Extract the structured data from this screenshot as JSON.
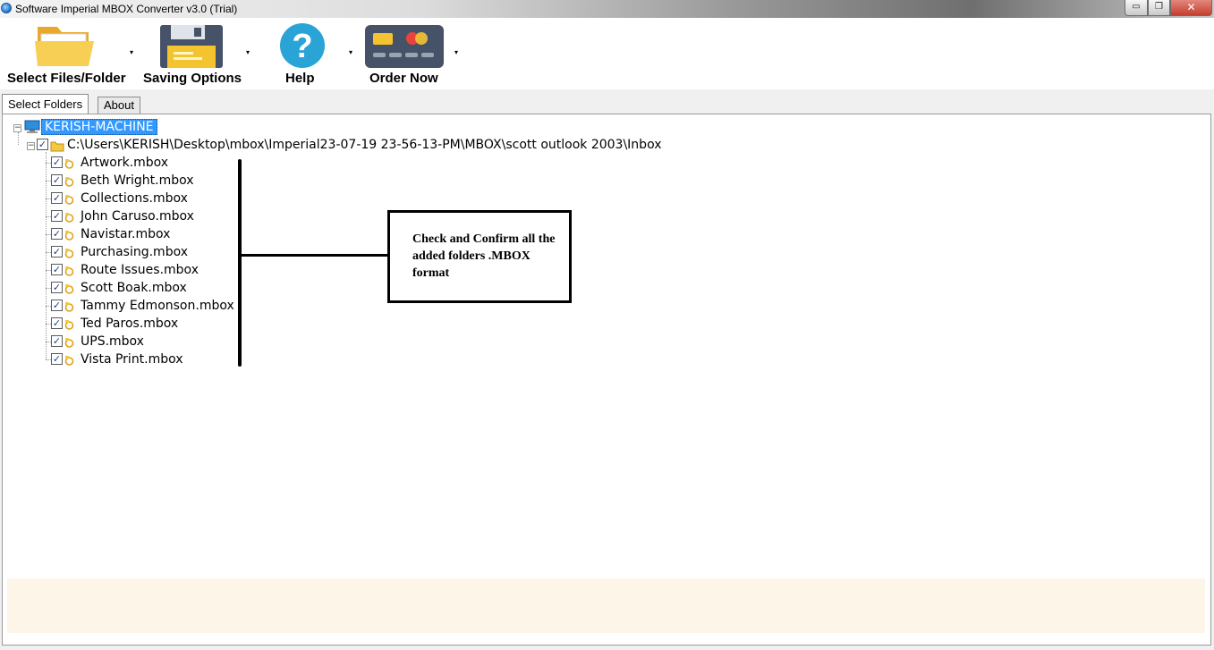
{
  "window": {
    "title": "Software Imperial MBOX Converter v3.0 (Trial)",
    "min_glyph": "▭",
    "max_glyph": "❐",
    "close_glyph": "✕"
  },
  "toolbar": {
    "arrow_glyph": "▾",
    "items": [
      {
        "label": "Select Files/Folder",
        "icon": "folder-icon"
      },
      {
        "label": "Saving Options",
        "icon": "floppy-disk-icon"
      },
      {
        "label": "Help",
        "icon": "help-question-icon"
      },
      {
        "label": "Order Now",
        "icon": "credit-card-icon"
      }
    ]
  },
  "tabs": [
    {
      "label": "Select Folders",
      "active": true
    },
    {
      "label": "About",
      "active": false
    }
  ],
  "tree": {
    "check_glyph": "✓",
    "expander_glyph": "−",
    "root": "KERISH-MACHINE",
    "folder": "C:\\Users\\KERISH\\Desktop\\mbox\\Imperial23-07-19 23-56-13-PM\\MBOX\\scott outlook 2003\\Inbox",
    "files": [
      "Artwork.mbox",
      "Beth Wright.mbox",
      "Collections.mbox",
      "John Caruso.mbox",
      "Navistar.mbox",
      "Purchasing.mbox",
      "Route Issues.mbox",
      "Scott Boak.mbox",
      "Tammy Edmonson.mbox",
      "Ted Paros.mbox",
      "UPS.mbox",
      "Vista Print.mbox"
    ]
  },
  "callout": {
    "text": "Check and Confirm all the added folders .MBOX format"
  },
  "colors": {
    "selection": "#3399ff",
    "status_bg": "#fdf5e8",
    "help_icon": "#2aa3d6",
    "folder_icon": "#f5c842"
  }
}
